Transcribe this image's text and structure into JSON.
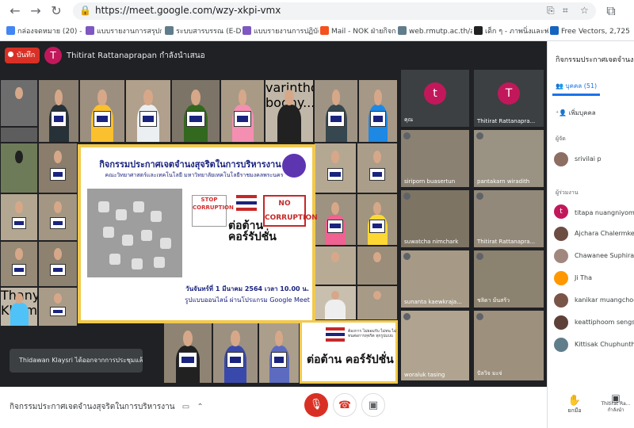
{
  "browser": {
    "url": "https://meet.google.com/wzy-xkpi-vmx"
  },
  "bookmarks": [
    {
      "label": "กล่องจดหมาย (20) - ti...",
      "color": "#4285f4"
    },
    {
      "label": "แบบรายงานการสรุปก...",
      "color": "#7e57c2"
    },
    {
      "label": "ระบบสารบรรณ (E-Do...",
      "color": "#607d8b"
    },
    {
      "label": "แบบรายงานการปฏิบัติง...",
      "color": "#7e57c2"
    },
    {
      "label": "Mail - NOK ฝ่ายกิจก...",
      "color": "#f4511e"
    },
    {
      "label": "web.rmutp.ac.th/atc...",
      "color": "#607d8b"
    },
    {
      "label": "เด็ก ๆ - ภาพนิ่งและฟรี...",
      "color": "#212121"
    },
    {
      "label": "Free Vectors, 2,725,...",
      "color": "#1565c0"
    }
  ],
  "meet": {
    "record_label": "บันทึก",
    "presenter_initial": "T",
    "presenter_text": "Thitirat Rattanaprapan กำลังนำเสนอ",
    "toast": "Thidawan Klaysri ได้ออกจากการประชุมแล้ว",
    "meeting_name": "กิจกรรมประกาศเจตจำนงสุจริตในการบริหารงาน",
    "controls": {
      "mic": "🎙",
      "end": "☎",
      "cam": "▣"
    }
  },
  "side_tiles": [
    {
      "name": "คุณ",
      "initial": "t",
      "color": "#c2185b"
    },
    {
      "name": "Thitirat Rattanapra...",
      "initial": "T",
      "color": "#c2185b"
    },
    {
      "name": "siriporn buasertun",
      "initial": "",
      "color": ""
    },
    {
      "name": "pantakarn wiradith",
      "initial": "",
      "color": ""
    },
    {
      "name": "suwatcha nimchark",
      "initial": "",
      "color": ""
    },
    {
      "name": "Thitirat Rattanapra...",
      "initial": "",
      "color": ""
    },
    {
      "name": "sunanta kaewkraja...",
      "initial": "",
      "color": ""
    },
    {
      "name": "ชลิดา ม้นสร้ว",
      "initial": "",
      "color": ""
    },
    {
      "name": "woraluk tasing",
      "initial": "",
      "color": ""
    },
    {
      "name": "ปัลวิจ มะจ่",
      "initial": "",
      "color": ""
    }
  ],
  "grid_names": {
    "g1": "varinthorn boony...",
    "g2": "Thanyaporn Khamrun"
  },
  "poster": {
    "title": "กิจกรรมประกาศเจตจำนงสุจริตในการบริหารงาน",
    "subtitle": "คณะวิทยาศาสตร์และเทคโนโลยี มหาวิทยาลัยเทคโนโลยีราชมงคลพระนคร",
    "stop": "STOP CORRUPTION",
    "no_corruption": "NO CORRUPTION",
    "oppose": "ต่อต้าน คอร์รัปชั่น",
    "date": "วันจันทร์ที่ 1 มีนาคม 2564 เวลา 10.00 น.",
    "mode": "รูปแบบออนไลน์ ผ่านโปรแกรม Google Meet"
  },
  "poster2": {
    "small": "ต้องการ ไม่ยอมรับ ไม่ทน ไม่ทนต่อการทุจริต ทุกรูปแบบ",
    "oppose": "ต่อต้าน คอร์รัปชั่น"
  },
  "panel": {
    "title": "กิจกรรมประกาศเจตจำนงสุจ",
    "tab": "บุคคล (51)",
    "add_people": "เพิ่มบุคคล",
    "section_host": "ผู้จัด",
    "section_attendees": "ผู้ร่วมงาน",
    "host": {
      "name": "srivilai p"
    },
    "people": [
      {
        "name": "titapa nuangniyom (คุณ)",
        "initial": "t"
      },
      {
        "name": "Ajchara Chalermkeart",
        "initial": ""
      },
      {
        "name": "Chawanee Suphirat",
        "initial": ""
      },
      {
        "name": "Ji Tha",
        "initial": ""
      },
      {
        "name": "kanikar muangchoo",
        "initial": ""
      },
      {
        "name": "keattiphoom sengsamu",
        "initial": ""
      },
      {
        "name": "Kittisak Chuphuntha",
        "initial": ""
      }
    ],
    "raise_hand": "ยกมือ",
    "presenter_bottom": "Thitirat Ra... กำลังนำ"
  }
}
